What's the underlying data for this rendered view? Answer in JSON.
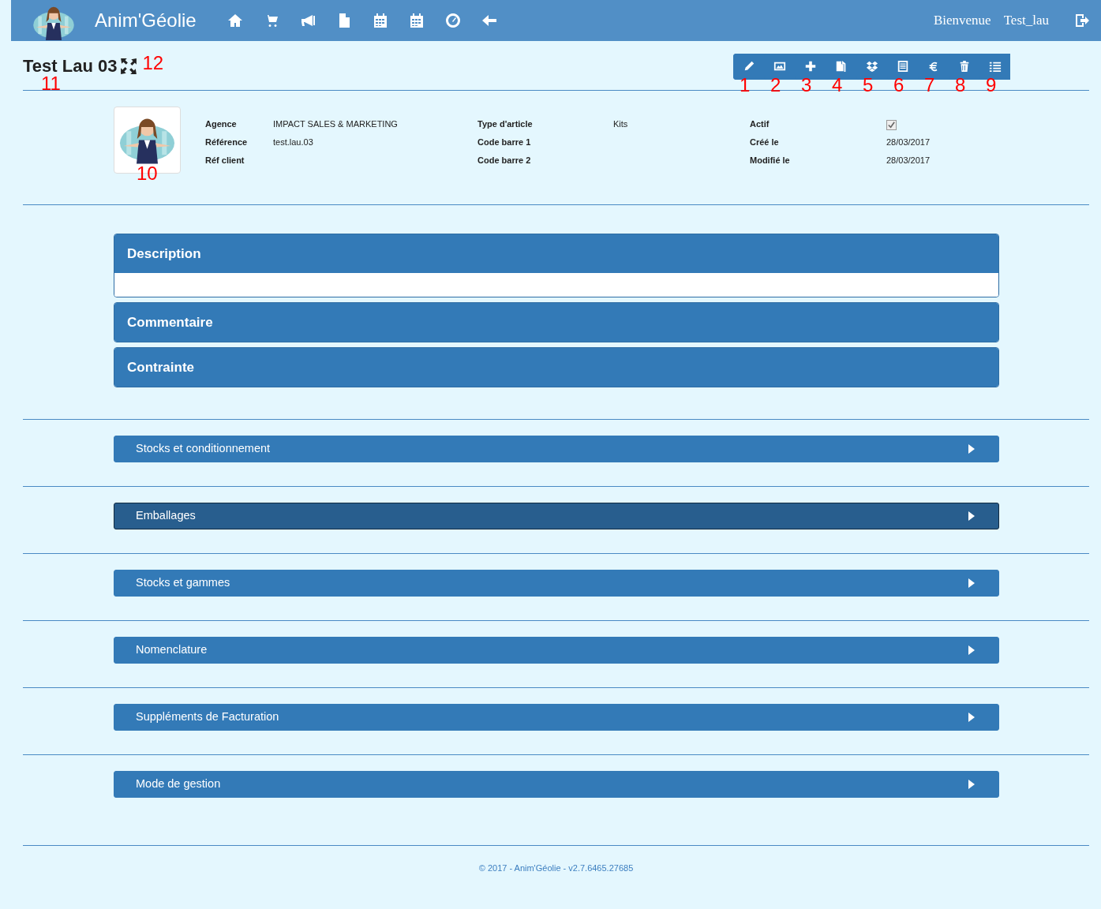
{
  "navbar": {
    "brand": "Anim'Géolie",
    "nav_icons": [
      {
        "kind": "home"
      },
      {
        "kind": "cart"
      },
      {
        "kind": "bullhorn"
      },
      {
        "kind": "file"
      },
      {
        "kind": "calendar"
      },
      {
        "kind": "calendar"
      },
      {
        "kind": "dashboard"
      },
      {
        "kind": "back"
      }
    ],
    "greeting": "Bienvenue",
    "user": "Test_lau"
  },
  "header": {
    "title": "Test Lau 03",
    "title_annotation": "11",
    "expand_annotation": "12",
    "toolbar": [
      {
        "kind": "pencil",
        "annotation": "1"
      },
      {
        "kind": "picture",
        "annotation": "2"
      },
      {
        "kind": "plus",
        "annotation": "3"
      },
      {
        "kind": "copy",
        "annotation": "4"
      },
      {
        "kind": "dropbox",
        "annotation": "5"
      },
      {
        "kind": "list-alt",
        "annotation": "6"
      },
      {
        "kind": "euro",
        "annotation": "7"
      },
      {
        "kind": "trash",
        "annotation": "8"
      },
      {
        "kind": "list",
        "annotation": "9"
      }
    ]
  },
  "details": {
    "photo_annotation": "10",
    "columns": [
      [
        {
          "label": "Agence",
          "value": "IMPACT SALES & MARKETING"
        },
        {
          "label": "Référence",
          "value": "test.lau.03"
        },
        {
          "label": "Réf client"
        }
      ],
      [
        {
          "label": "Type d'article",
          "value": "Kits"
        },
        {
          "label": "Code barre 1"
        },
        {
          "label": "Code barre 2"
        }
      ],
      [
        {
          "label": "Actif",
          "kind": "checkbox",
          "checked": true
        },
        {
          "label": "Créé le",
          "value": "28/03/2017"
        },
        {
          "label": "Modifié le",
          "value": "28/03/2017"
        }
      ]
    ]
  },
  "panels": [
    {
      "title": "Description",
      "expanded": true
    },
    {
      "title": "Commentaire",
      "expanded": false
    },
    {
      "title": "Contrainte",
      "expanded": false
    }
  ],
  "sections": [
    {
      "title": "Stocks et conditionnement",
      "selected": false
    },
    {
      "title": "Emballages",
      "selected": true
    },
    {
      "title": "Stocks et gammes",
      "selected": false
    },
    {
      "title": "Nomenclature",
      "selected": false
    },
    {
      "title": "Suppléments de Facturation",
      "selected": false
    },
    {
      "title": "Mode de gestion",
      "selected": false
    }
  ],
  "footer": "© 2017 - Anim'Géolie - v2.7.6465.27685"
}
